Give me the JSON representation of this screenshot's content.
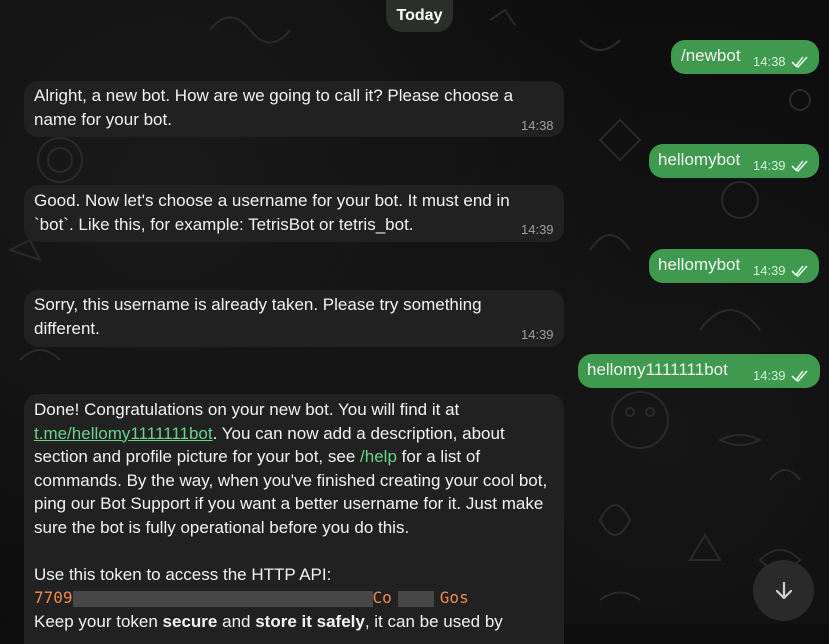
{
  "chat": {
    "date_label": "Today",
    "messages": [
      {
        "from": "me",
        "text": "/newbot",
        "time": "14:38"
      },
      {
        "from": "bot",
        "text": "Alright, a new bot. How are we going to call it? Please choose a name for your bot.",
        "time": "14:38"
      },
      {
        "from": "me",
        "text": "hellomybot",
        "time": "14:39"
      },
      {
        "from": "bot",
        "text": "Good. Now let's choose a username for your bot. It must end in `bot`. Like this, for example: TetrisBot or tetris_bot.",
        "time": "14:39"
      },
      {
        "from": "me",
        "text": "hellomybot",
        "time": "14:39"
      },
      {
        "from": "bot",
        "text": "Sorry, this username is already taken. Please try something different.",
        "time": "14:39"
      },
      {
        "from": "me",
        "text": "hellomy1111111bot",
        "time": "14:39"
      }
    ],
    "done_message": {
      "line_start": "Done! Congratulations on your new bot. You will find it at",
      "bot_link": "t.me/hellomy1111111bot",
      "after_link": ". You can now add a description, about section and profile picture for your bot, see",
      "help_command": "/help",
      "after_help": "for a list of commands. By the way, when you've finished creating your cool bot, ping our Bot Support if you want a better username for it. Just make sure the bot is fully operational before you do this.",
      "token_intro": "Use this token to access the HTTP API:",
      "token_visible_start": "7709",
      "token_visible_mid": "Co",
      "token_visible_end": "Gos",
      "keep_prefix": "Keep your token",
      "keep_bold1": "secure",
      "keep_and": "and",
      "keep_bold2": "store it safely",
      "keep_suffix": ", it can be used by"
    }
  },
  "icons": {
    "read_status": "double-check-icon",
    "scroll_down": "arrow-down-icon"
  },
  "colors": {
    "outgoing_bubble": "#3f9a4f",
    "incoming_bubble": "#212121",
    "link": "#69d48a",
    "token": "#f0894a"
  }
}
